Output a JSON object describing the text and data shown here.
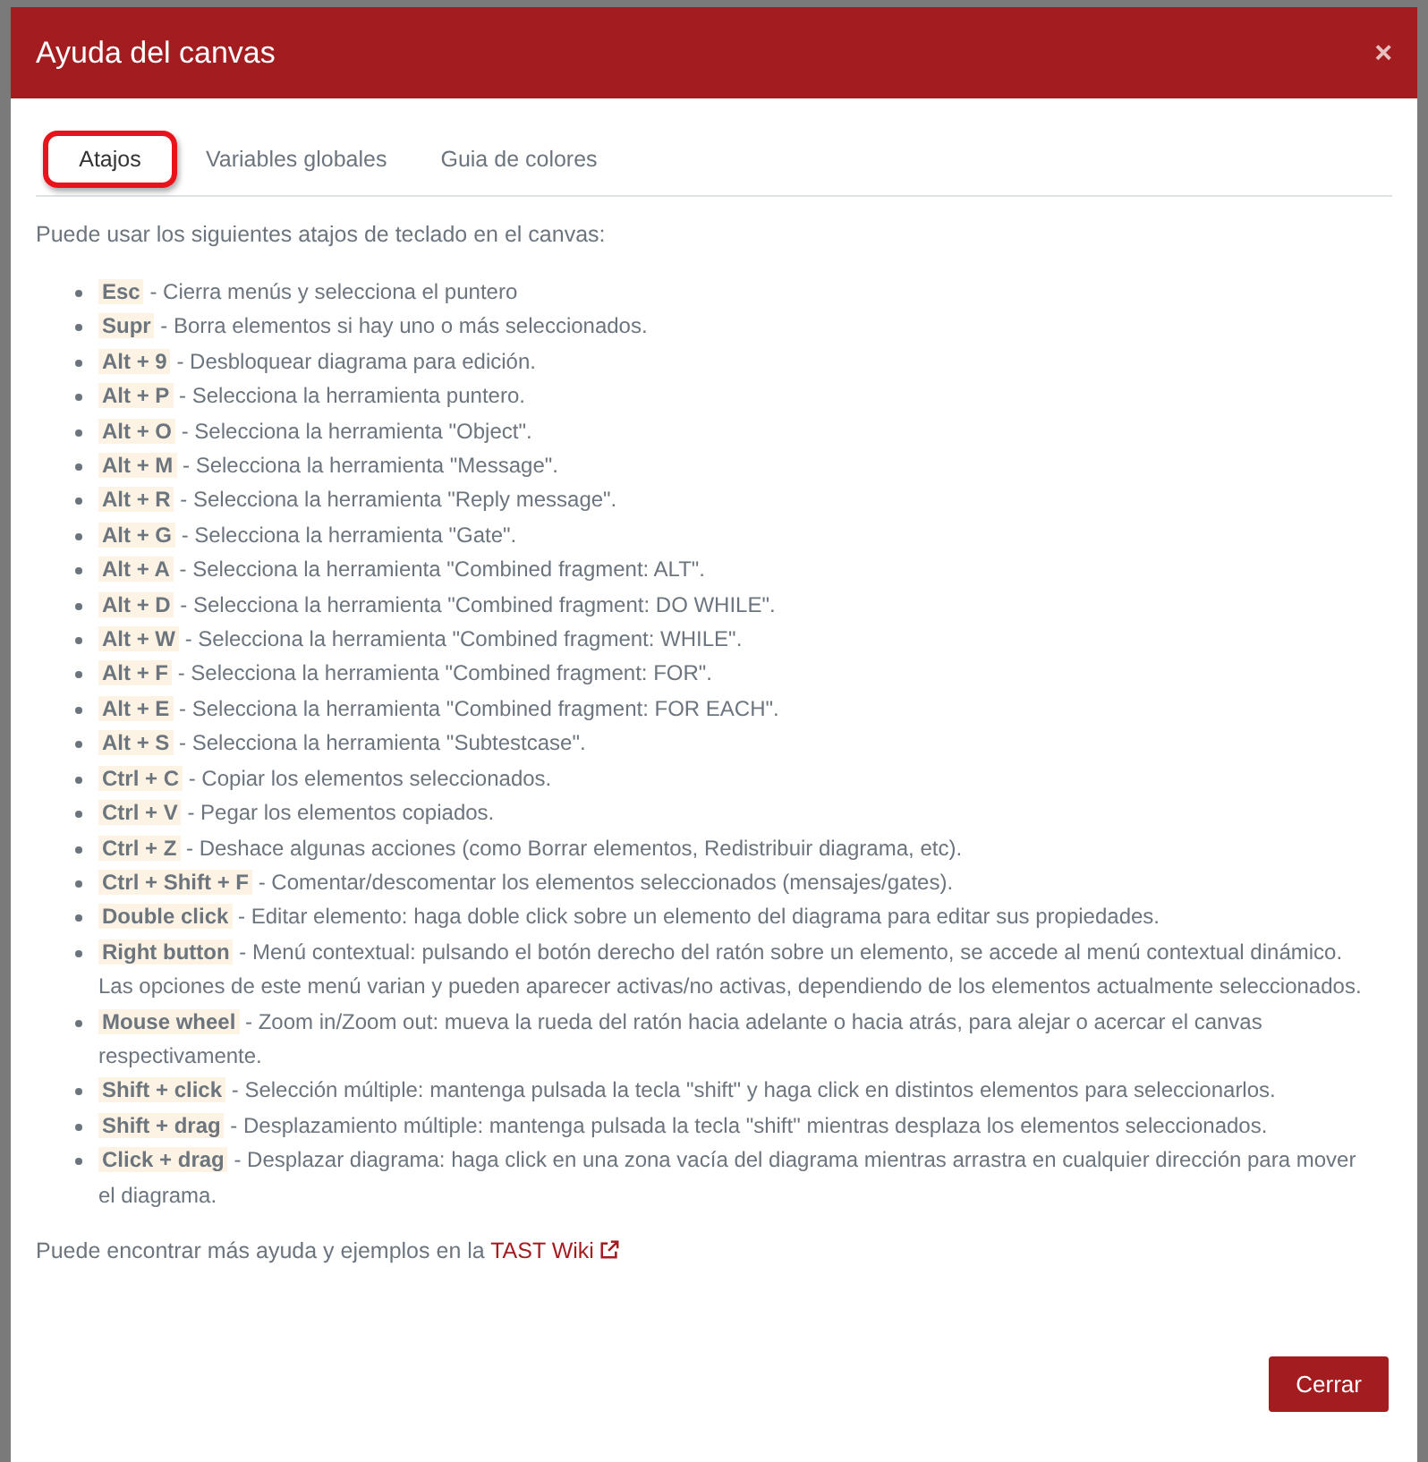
{
  "modal": {
    "title": "Ayuda del canvas",
    "close": "×"
  },
  "tabs": [
    {
      "label": "Atajos",
      "selected": true
    },
    {
      "label": "Variables globales",
      "selected": false
    },
    {
      "label": "Guia de colores",
      "selected": false
    }
  ],
  "intro": "Puede usar los siguientes atajos de teclado en el canvas:",
  "shortcuts": [
    {
      "key": "Esc",
      "description": "- Cierra menús y selecciona el puntero"
    },
    {
      "key": "Supr",
      "description": "- Borra elementos si hay uno o más seleccionados."
    },
    {
      "key": "Alt + 9",
      "description": "- Desbloquear diagrama para edición."
    },
    {
      "key": "Alt + P",
      "description": "- Selecciona la herramienta puntero."
    },
    {
      "key": "Alt + O",
      "description": "- Selecciona la herramienta \"Object\"."
    },
    {
      "key": "Alt + M",
      "description": "- Selecciona la herramienta \"Message\"."
    },
    {
      "key": "Alt + R",
      "description": "- Selecciona la herramienta \"Reply message\"."
    },
    {
      "key": "Alt + G",
      "description": "- Selecciona la herramienta \"Gate\"."
    },
    {
      "key": "Alt + A",
      "description": "- Selecciona la herramienta \"Combined fragment: ALT\"."
    },
    {
      "key": "Alt + D",
      "description": "- Selecciona la herramienta \"Combined fragment: DO WHILE\"."
    },
    {
      "key": "Alt + W",
      "description": "- Selecciona la herramienta \"Combined fragment: WHILE\"."
    },
    {
      "key": "Alt + F",
      "description": "- Selecciona la herramienta \"Combined fragment: FOR\"."
    },
    {
      "key": "Alt + E",
      "description": "- Selecciona la herramienta \"Combined fragment: FOR EACH\"."
    },
    {
      "key": "Alt + S",
      "description": "- Selecciona la herramienta \"Subtestcase\"."
    },
    {
      "key": "Ctrl + C",
      "description": "- Copiar los elementos seleccionados."
    },
    {
      "key": "Ctrl + V",
      "description": "- Pegar los elementos copiados."
    },
    {
      "key": "Ctrl + Z",
      "description": "- Deshace algunas acciones (como Borrar elementos, Redistribuir diagrama, etc)."
    },
    {
      "key": "Ctrl + Shift + F",
      "description": "- Comentar/descomentar los elementos seleccionados (mensajes/gates)."
    },
    {
      "key": "Double click",
      "description": "- Editar elemento: haga doble click sobre un elemento del diagrama para editar sus propiedades."
    },
    {
      "key": "Right button",
      "description": "- Menú contextual: pulsando el botón derecho del ratón sobre un elemento, se accede al menú contextual dinámico. Las opciones de este menú varian y pueden aparecer activas/no activas, dependiendo de los elementos actualmente seleccionados."
    },
    {
      "key": "Mouse wheel",
      "description": "- Zoom in/Zoom out: mueva la rueda del ratón hacia adelante o hacia atrás, para alejar o acercar el canvas respectivamente."
    },
    {
      "key": "Shift + click",
      "description": "- Selección múltiple: mantenga pulsada la tecla \"shift\" y haga click en distintos elementos para seleccionarlos."
    },
    {
      "key": "Shift + drag",
      "description": "- Desplazamiento múltiple: mantenga pulsada la tecla \"shift\" mientras desplaza los elementos seleccionados."
    },
    {
      "key": "Click + drag",
      "description": "- Desplazar diagrama: haga click en una zona vacía del diagrama mientras arrastra en cualquier dirección para mover el diagrama."
    }
  ],
  "footer_note": {
    "text": "Puede encontrar más ayuda y ejemplos en la ",
    "link": "TAST Wiki"
  },
  "buttons": [
    "Cerrar"
  ]
}
